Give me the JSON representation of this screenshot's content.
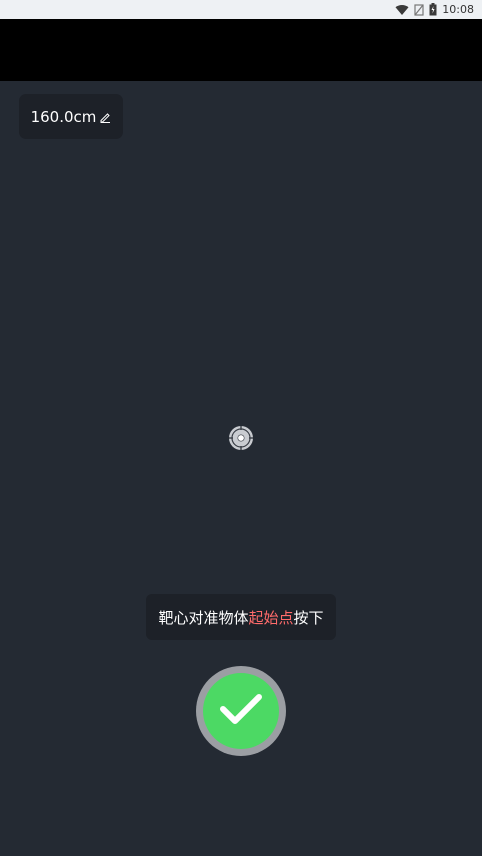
{
  "status_bar": {
    "time": "10:08",
    "icons": [
      "wifi-icon",
      "no-signal-icon",
      "battery-icon"
    ]
  },
  "measure": {
    "height_value": "160.0cm",
    "edit_icon": "pencil-icon"
  },
  "crosshair": {
    "icon": "crosshair-icon"
  },
  "hint": {
    "prefix": "靶心对准物体",
    "highlight": "起始点",
    "suffix": "按下",
    "highlight_color": "#ff6b6b"
  },
  "confirm_button": {
    "icon": "checkmark-icon",
    "color": "#4cd964"
  },
  "colors": {
    "background": "#242a33",
    "chip": "#1d2128"
  }
}
